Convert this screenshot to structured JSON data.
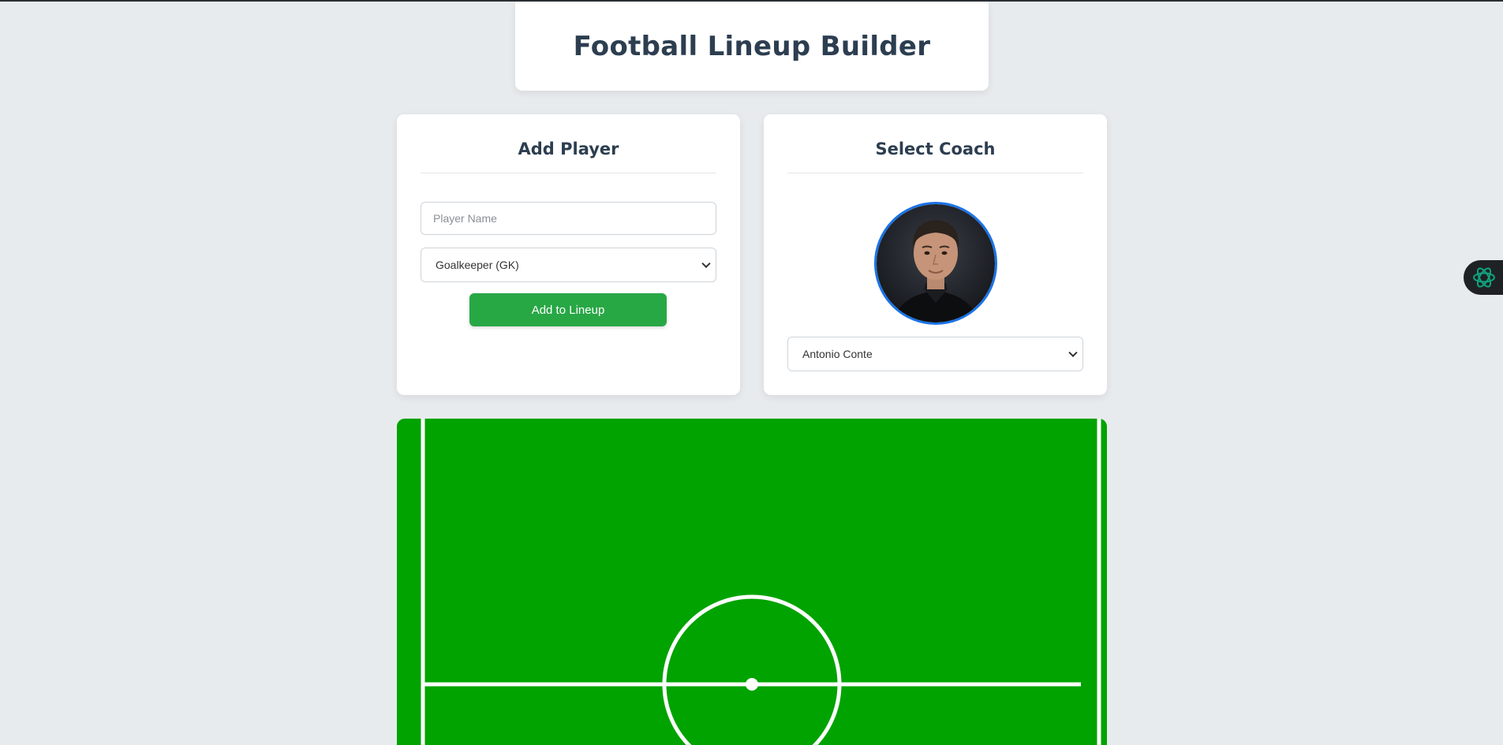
{
  "header": {
    "title": "Football Lineup Builder"
  },
  "add_player": {
    "title": "Add Player",
    "name_placeholder": "Player Name",
    "name_value": "",
    "position_selected": "Goalkeeper (GK)",
    "button_label": "Add to Lineup"
  },
  "coach": {
    "title": "Select Coach",
    "selected": "Antonio Conte"
  },
  "colors": {
    "accent_green": "#28a745",
    "pitch_green": "#00a300",
    "title_text": "#2c3e50",
    "coach_border": "#1a73e8",
    "extension_accent": "#10a37f"
  },
  "icons": {
    "extension": "openai-knot-icon",
    "select_arrow": "chevron-down-icon"
  }
}
